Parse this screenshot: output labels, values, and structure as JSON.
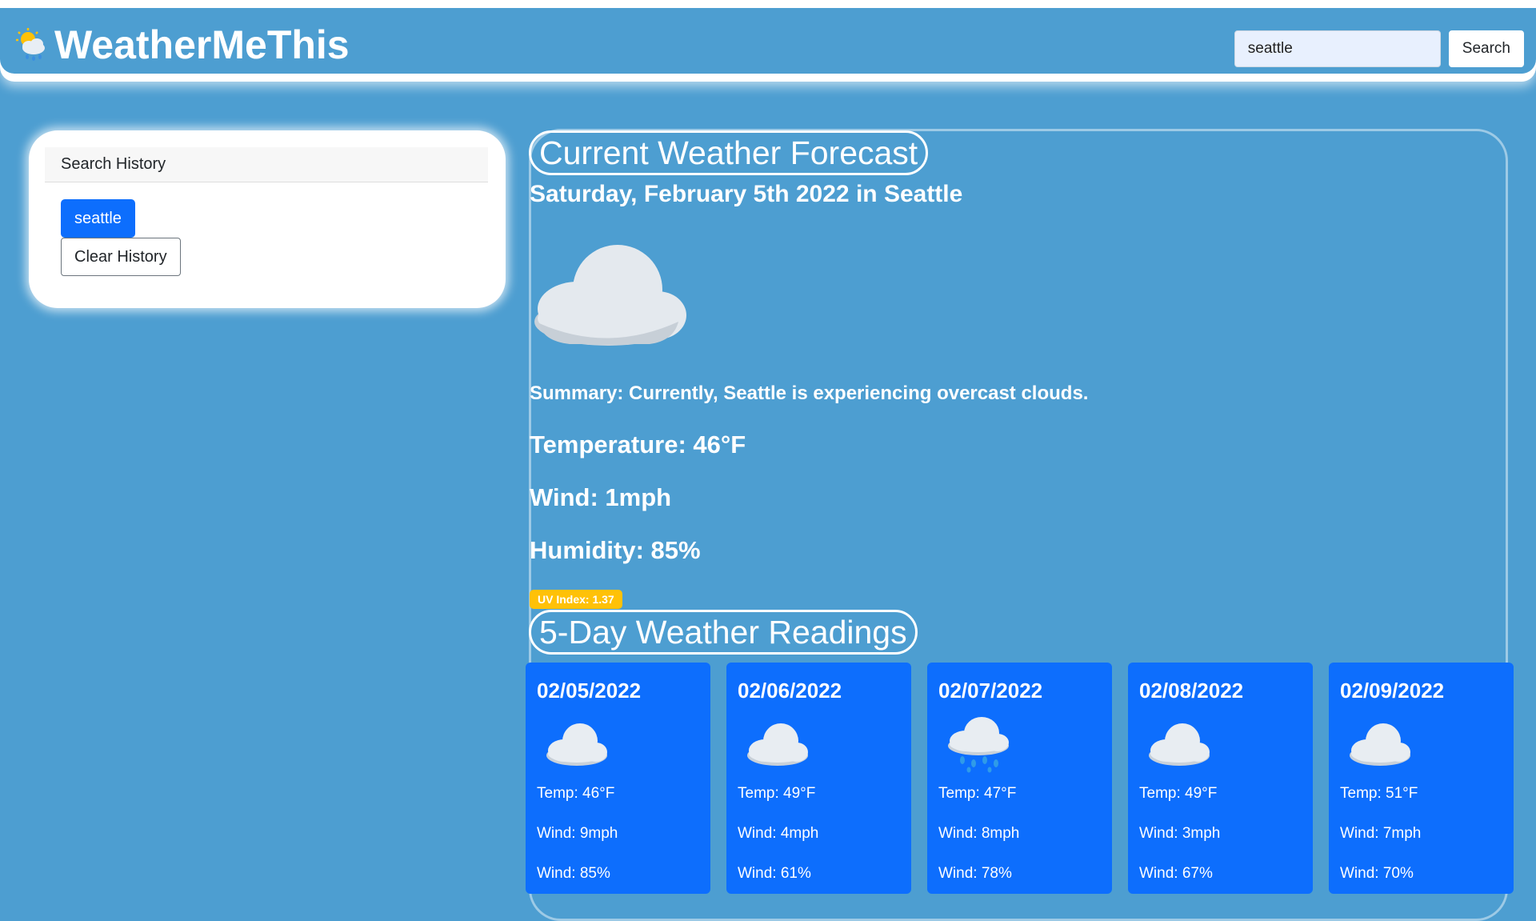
{
  "app": {
    "title": "WeatherMeThis",
    "logo_icon": "sun-behind-rain-cloud-icon"
  },
  "search": {
    "value": "seattle",
    "placeholder": "",
    "button_label": "Search"
  },
  "sidebar": {
    "header": "Search History",
    "history": [
      "seattle"
    ],
    "clear_label": "Clear History"
  },
  "current": {
    "heading": "Current Weather Forecast",
    "date_line": "Saturday, February 5th 2022 in Seattle",
    "icon": "cloud-icon",
    "summary": "Summary: Currently, Seattle is experiencing overcast clouds.",
    "temperature": "Temperature: 46°F",
    "wind": "Wind: 1mph",
    "humidity": "Humidity: 85%",
    "uv": "UV Index: 1.37"
  },
  "forecast": {
    "heading": "5-Day Weather Readings",
    "days": [
      {
        "date": "02/05/2022",
        "icon": "cloud-icon",
        "temp": "Temp: 46°F",
        "wind": "Wind: 9mph",
        "hum": "Wind: 85%"
      },
      {
        "date": "02/06/2022",
        "icon": "cloud-icon",
        "temp": "Temp: 49°F",
        "wind": "Wind: 4mph",
        "hum": "Wind: 61%"
      },
      {
        "date": "02/07/2022",
        "icon": "rain-cloud-icon",
        "temp": "Temp: 47°F",
        "wind": "Wind: 8mph",
        "hum": "Wind: 78%"
      },
      {
        "date": "02/08/2022",
        "icon": "cloud-icon",
        "temp": "Temp: 49°F",
        "wind": "Wind: 3mph",
        "hum": "Wind: 67%"
      },
      {
        "date": "02/09/2022",
        "icon": "cloud-icon",
        "temp": "Temp: 51°F",
        "wind": "Wind: 7mph",
        "hum": "Wind: 70%"
      }
    ]
  },
  "colors": {
    "background": "#4d9ed1",
    "card": "#0d6efd",
    "uv_badge": "#ffc107",
    "white": "#ffffff"
  }
}
